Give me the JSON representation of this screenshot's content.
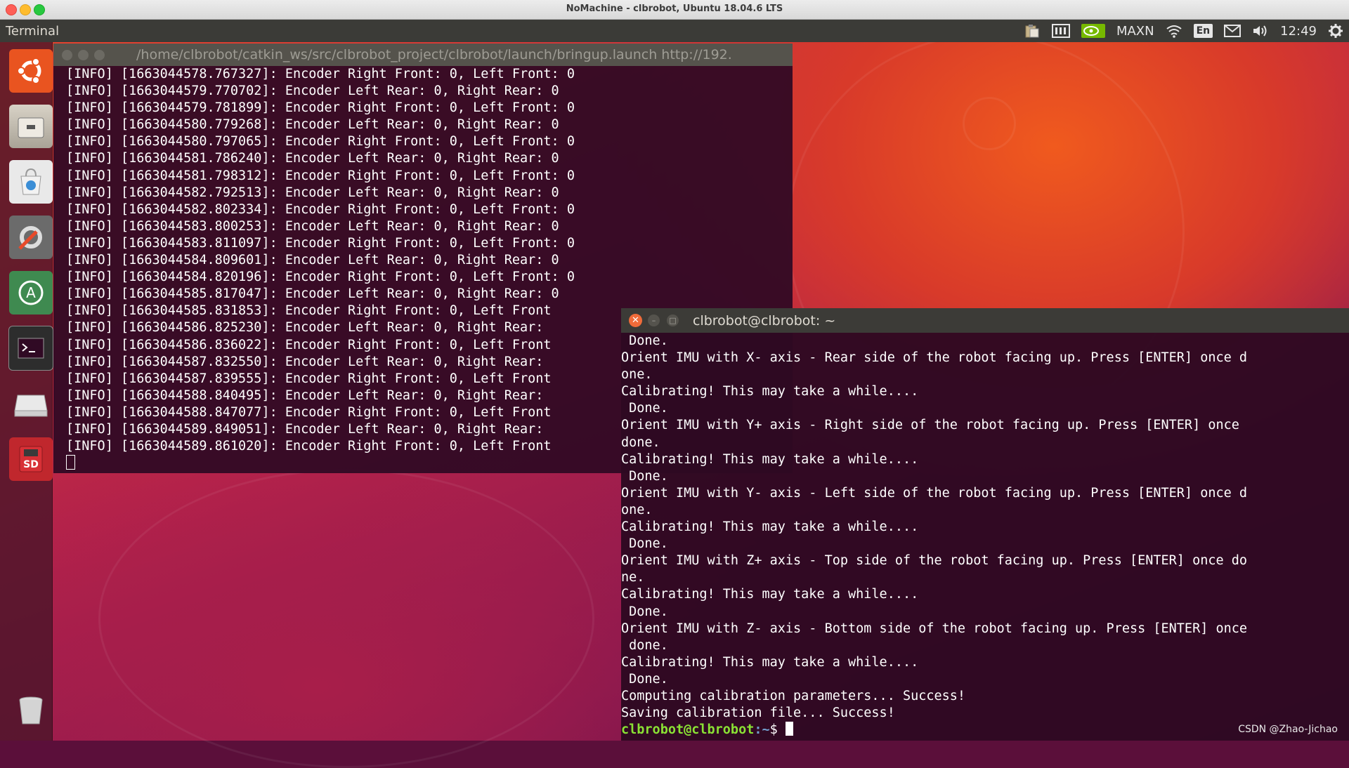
{
  "mac_window": {
    "title": "NoMachine - clbrobot, Ubuntu 18.04.6 LTS"
  },
  "top_panel": {
    "app_name": "Terminal",
    "tray": {
      "nvidia_mode": "MAXN",
      "lang": "En",
      "clock": "12:49"
    }
  },
  "launcher": {
    "items": [
      {
        "icon": "ubuntu-logo-icon"
      },
      {
        "icon": "files-icon"
      },
      {
        "icon": "software-center-icon"
      },
      {
        "icon": "system-settings-icon"
      },
      {
        "icon": "software-updater-icon"
      },
      {
        "icon": "terminal-icon"
      },
      {
        "icon": "drive-icon"
      },
      {
        "icon": "sd-card-icon",
        "label": "SD"
      },
      {
        "icon": "trash-icon"
      }
    ]
  },
  "terminal1": {
    "title": "/home/clbrobot/catkin_ws/src/clbrobot_project/clbrobot/launch/bringup.launch http://192.",
    "lines": [
      "[INFO] [1663044578.767327]: Encoder Right Front: 0, Left Front: 0",
      "[INFO] [1663044579.770702]: Encoder Left Rear: 0, Right Rear: 0",
      "[INFO] [1663044579.781899]: Encoder Right Front: 0, Left Front: 0",
      "[INFO] [1663044580.779268]: Encoder Left Rear: 0, Right Rear: 0",
      "[INFO] [1663044580.797065]: Encoder Right Front: 0, Left Front: 0",
      "[INFO] [1663044581.786240]: Encoder Left Rear: 0, Right Rear: 0",
      "[INFO] [1663044581.798312]: Encoder Right Front: 0, Left Front: 0",
      "[INFO] [1663044582.792513]: Encoder Left Rear: 0, Right Rear: 0",
      "[INFO] [1663044582.802334]: Encoder Right Front: 0, Left Front: 0",
      "[INFO] [1663044583.800253]: Encoder Left Rear: 0, Right Rear: 0",
      "[INFO] [1663044583.811097]: Encoder Right Front: 0, Left Front: 0",
      "[INFO] [1663044584.809601]: Encoder Left Rear: 0, Right Rear: 0",
      "[INFO] [1663044584.820196]: Encoder Right Front: 0, Left Front: 0",
      "[INFO] [1663044585.817047]: Encoder Left Rear: 0, Right Rear: 0",
      "[INFO] [1663044585.831853]: Encoder Right Front: 0, Left Front",
      "[INFO] [1663044586.825230]: Encoder Left Rear: 0, Right Rear:",
      "[INFO] [1663044586.836022]: Encoder Right Front: 0, Left Front",
      "[INFO] [1663044587.832550]: Encoder Left Rear: 0, Right Rear:",
      "[INFO] [1663044587.839555]: Encoder Right Front: 0, Left Front",
      "[INFO] [1663044588.840495]: Encoder Left Rear: 0, Right Rear:",
      "[INFO] [1663044588.847077]: Encoder Right Front: 0, Left Front",
      "[INFO] [1663044589.849051]: Encoder Left Rear: 0, Right Rear:",
      "[INFO] [1663044589.861020]: Encoder Right Front: 0, Left Front"
    ]
  },
  "terminal2": {
    "title": "clbrobot@clbrobot: ~",
    "lines": [
      " Done.",
      "Orient IMU with X- axis - Rear side of the robot facing up. Press [ENTER] once d",
      "one.",
      "Calibrating! This may take a while....",
      " Done.",
      "Orient IMU with Y+ axis - Right side of the robot facing up. Press [ENTER] once",
      "done.",
      "Calibrating! This may take a while....",
      " Done.",
      "Orient IMU with Y- axis - Left side of the robot facing up. Press [ENTER] once d",
      "one.",
      "Calibrating! This may take a while....",
      " Done.",
      "Orient IMU with Z+ axis - Top side of the robot facing up. Press [ENTER] once do",
      "ne.",
      "Calibrating! This may take a while....",
      " Done.",
      "Orient IMU with Z- axis - Bottom side of the robot facing up. Press [ENTER] once",
      " done.",
      "Calibrating! This may take a while....",
      " Done.",
      "Computing calibration parameters... Success!",
      "Saving calibration file... Success!"
    ],
    "prompt_user": "clbrobot@clbrobot",
    "prompt_path": ":~",
    "prompt_symbol": "$ "
  },
  "watermark": "CSDN @Zhao-Jichao",
  "colors": {
    "prompt_user": "#8ae234",
    "prompt_path": "#729fcf",
    "close_button": "#f06b3a"
  }
}
